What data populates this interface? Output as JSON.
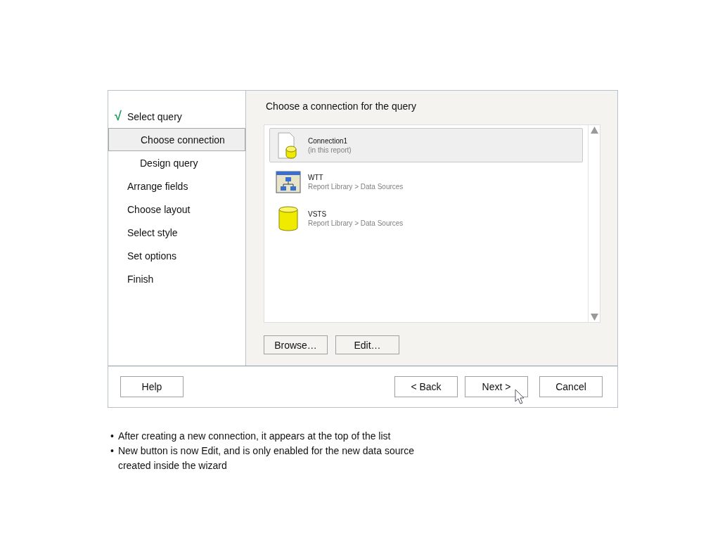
{
  "steps": [
    {
      "label": "Select query",
      "mark": "√",
      "selected": false,
      "children": [
        {
          "label": "Choose connection",
          "selected": true
        },
        {
          "label": "Design query",
          "selected": false
        }
      ]
    },
    {
      "label": "Arrange fields",
      "selected": false
    },
    {
      "label": "Choose layout",
      "selected": false
    },
    {
      "label": "Select style",
      "selected": false
    },
    {
      "label": "Set options",
      "selected": false
    },
    {
      "label": "Finish",
      "selected": false
    }
  ],
  "heading": "Choose a connection for the query",
  "connections": [
    {
      "kind": "document-database",
      "name": "Connection1",
      "location": "(in this report)",
      "selected": true
    },
    {
      "kind": "diagram",
      "name": "WTT",
      "location": "Report Library > Data Sources",
      "selected": false
    },
    {
      "kind": "database",
      "name": "VSTS",
      "location": "Report Library > Data Sources",
      "selected": false
    }
  ],
  "list_buttons": [
    "Browse…",
    "Edit…"
  ],
  "footer": {
    "help": "Help",
    "buttons": [
      "< Back",
      "Next >",
      "Cancel"
    ]
  },
  "notes": [
    {
      "bullet": "•",
      "text": "After creating a new connection, it appears at the top of the list"
    },
    {
      "bullet": "•",
      "text": "New button  is now Edit, and is only enabled  for the new data source created inside the wizard"
    }
  ]
}
